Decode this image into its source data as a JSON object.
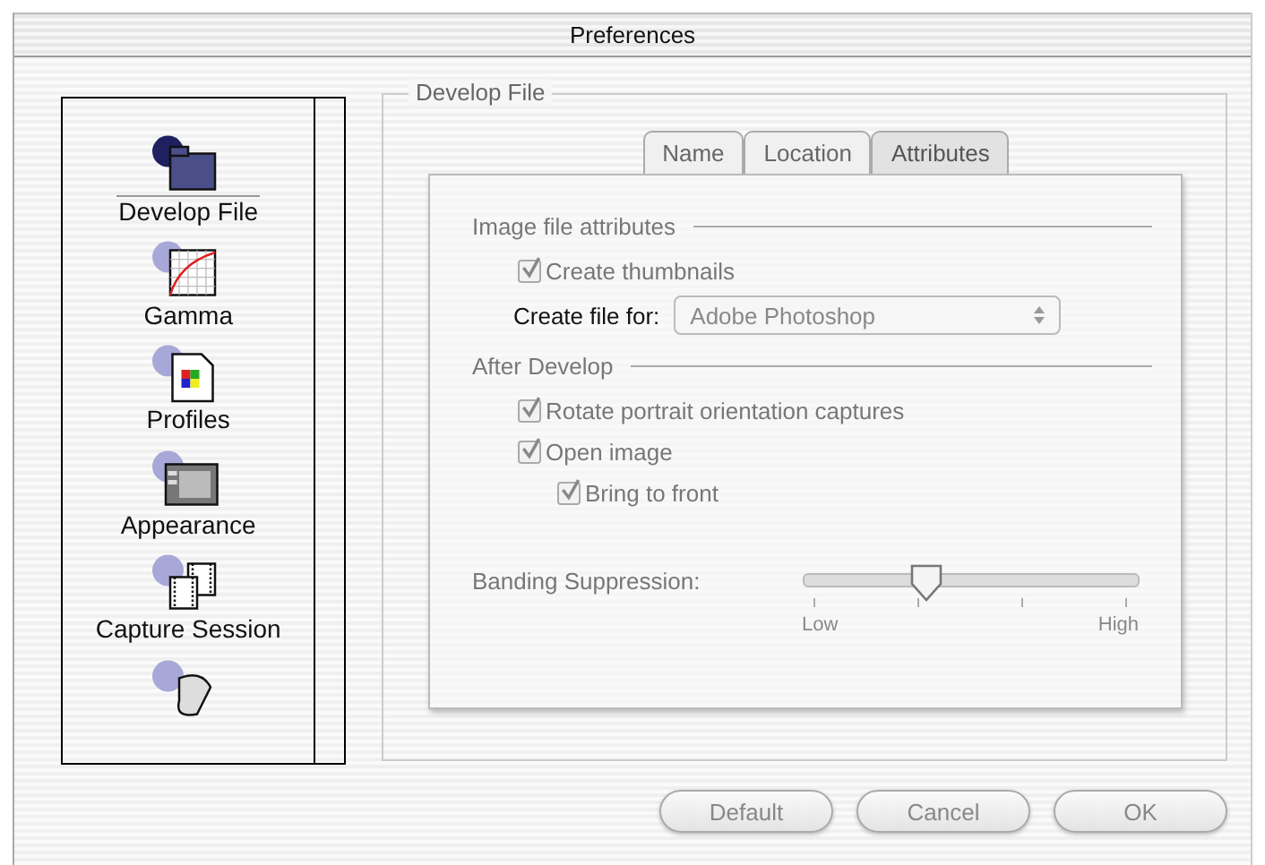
{
  "window": {
    "title": "Preferences"
  },
  "sidebar": {
    "items": [
      {
        "label": "Develop File",
        "selected": true
      },
      {
        "label": "Gamma",
        "selected": false
      },
      {
        "label": "Profiles",
        "selected": false
      },
      {
        "label": "Appearance",
        "selected": false
      },
      {
        "label": "Capture Session",
        "selected": false
      },
      {
        "selected": false
      }
    ]
  },
  "group": {
    "title": "Develop File"
  },
  "tabs": [
    {
      "label": "Name",
      "selected": false
    },
    {
      "label": "Location",
      "selected": false
    },
    {
      "label": "Attributes",
      "selected": true
    }
  ],
  "sections": [
    {
      "title": "Image file attributes",
      "rows": [
        {
          "kind": "checkbox",
          "label": "Create thumbnails",
          "checked": true,
          "disabled": true
        },
        {
          "kind": "popup",
          "label": "Create file for:",
          "value": "Adobe Photoshop",
          "disabled": true
        }
      ]
    },
    {
      "title": "After Develop",
      "rows": [
        {
          "kind": "checkbox",
          "label": "Rotate portrait orientation captures",
          "checked": true,
          "disabled": true
        },
        {
          "kind": "checkbox",
          "label": "Open image",
          "checked": true,
          "disabled": true,
          "children": [
            {
              "kind": "checkbox",
              "label": "Bring to front",
              "checked": true,
              "disabled": true
            }
          ]
        }
      ]
    }
  ],
  "slider": {
    "label": "Banding Suppression:",
    "level": 0.333,
    "min_label": "Low",
    "max_label": "High",
    "disabled": true
  },
  "buttons": [
    {
      "label": "Default",
      "disabled": true
    },
    {
      "label": "Cancel",
      "disabled": true
    },
    {
      "label": "OK",
      "disabled": true
    }
  ]
}
